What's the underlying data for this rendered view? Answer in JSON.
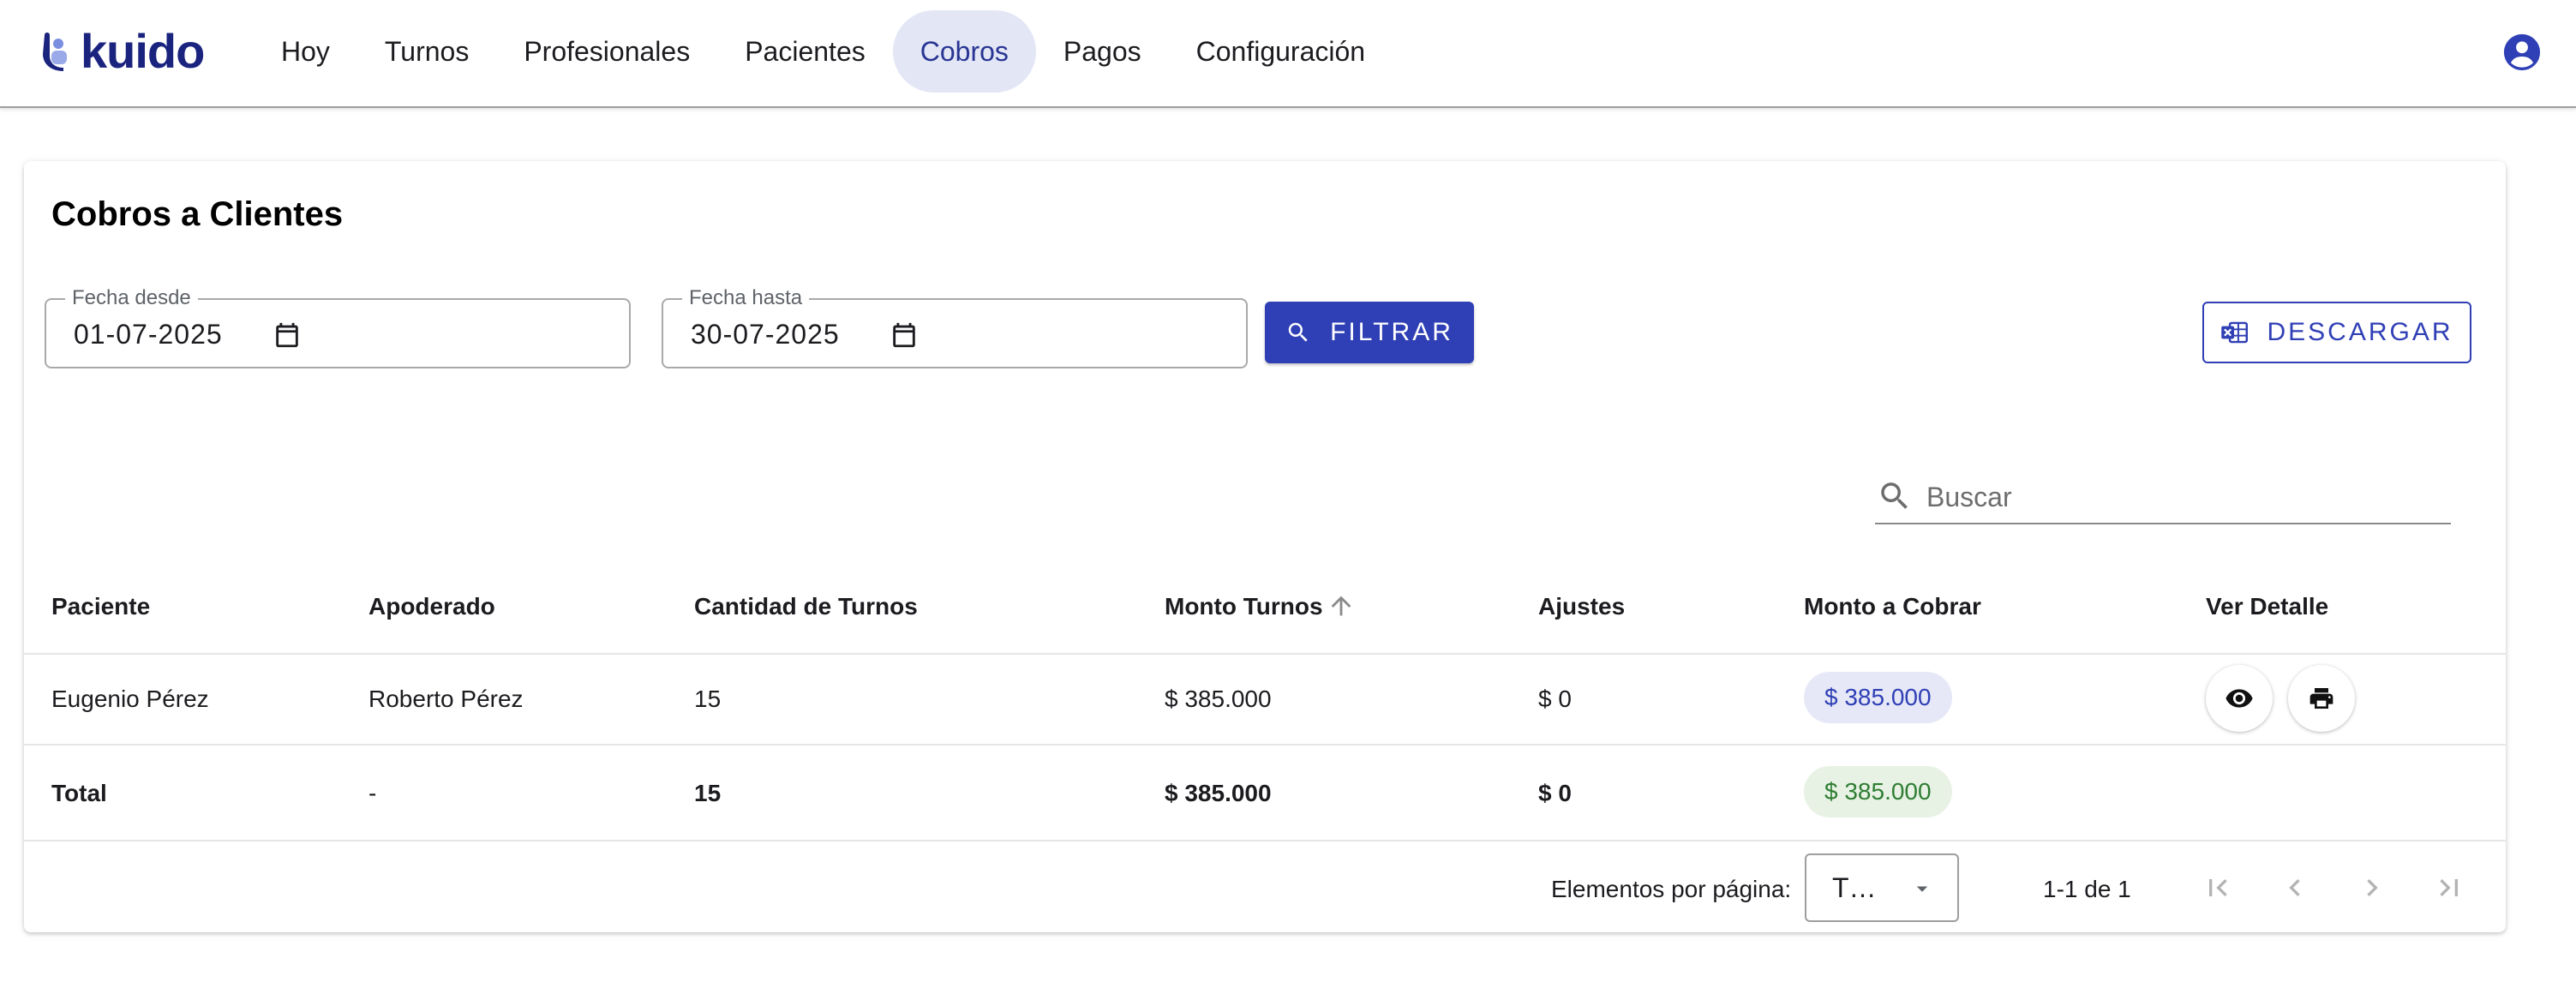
{
  "app": {
    "brand": "kuido"
  },
  "nav": {
    "items": [
      {
        "label": "Hoy",
        "active": false
      },
      {
        "label": "Turnos",
        "active": false
      },
      {
        "label": "Profesionales",
        "active": false
      },
      {
        "label": "Pacientes",
        "active": false
      },
      {
        "label": "Cobros",
        "active": true
      },
      {
        "label": "Pagos",
        "active": false
      },
      {
        "label": "Configuración",
        "active": false
      }
    ],
    "account_icon": "account-circle-icon"
  },
  "page": {
    "title": "Cobros a Clientes"
  },
  "filters": {
    "from": {
      "label": "Fecha desde",
      "value": "01-07-2025"
    },
    "to": {
      "label": "Fecha hasta",
      "value": "30-07-2025"
    },
    "filter_button": "FILTRAR",
    "download_button": "DESCARGAR"
  },
  "search": {
    "placeholder": "Buscar"
  },
  "table": {
    "headers": {
      "patient": "Paciente",
      "guardian": "Apoderado",
      "count": "Cantidad de Turnos",
      "amount": "Monto Turnos",
      "adjustments": "Ajustes",
      "to_charge": "Monto a Cobrar",
      "detail": "Ver Detalle"
    },
    "sort": {
      "column": "amount",
      "direction": "asc"
    },
    "rows": [
      {
        "patient": "Eugenio Pérez",
        "guardian": "Roberto Pérez",
        "count": "15",
        "amount": "$ 385.000",
        "adjustments": "$ 0",
        "to_charge": "$ 385.000"
      }
    ],
    "total": {
      "label": "Total",
      "guardian": "-",
      "count": "15",
      "amount": "$ 385.000",
      "adjustments": "$ 0",
      "to_charge": "$ 385.000"
    }
  },
  "paginator": {
    "items_label": "Elementos por página:",
    "page_size": "T…",
    "range": "1-1 de 1"
  },
  "colors": {
    "primary": "#2f3fb5",
    "nav_active_bg": "#e3e6f5",
    "chip_blue_bg": "#e6e8f7",
    "chip_green_bg": "#e7f2e5",
    "chip_green_text": "#2e7d32"
  }
}
